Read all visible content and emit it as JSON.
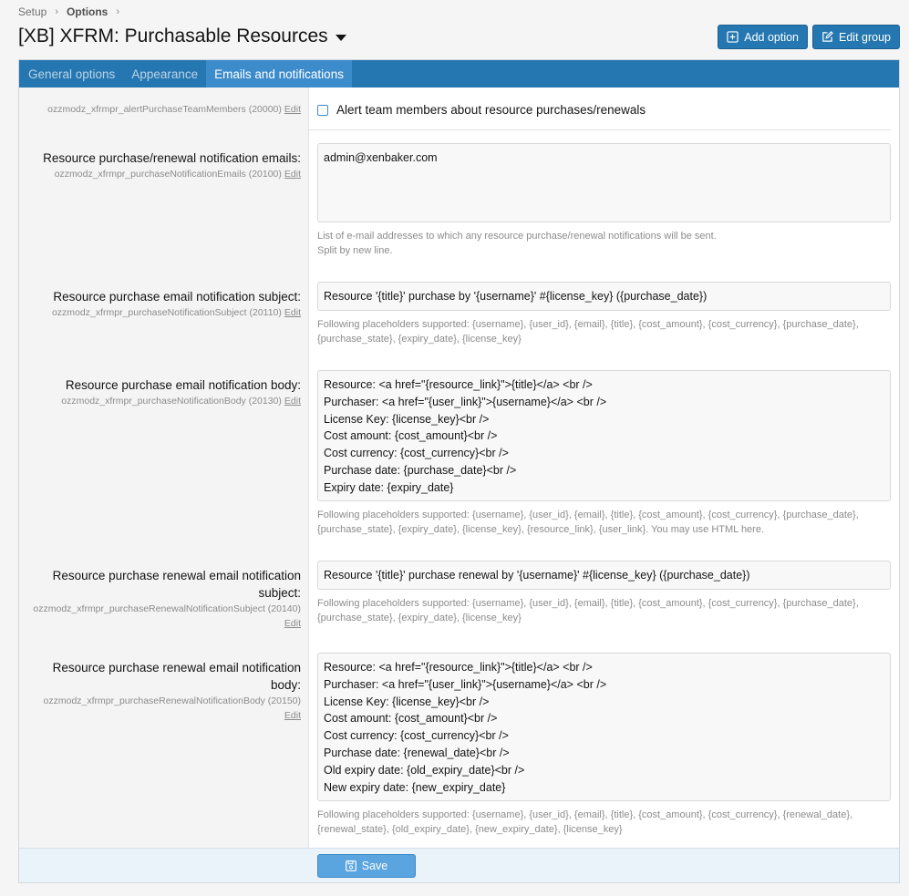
{
  "breadcrumb": {
    "items": [
      "Setup",
      "Options"
    ]
  },
  "page_title": "[XB] XFRM: Purchasable Resources",
  "buttons": {
    "add_option": "Add option",
    "edit_group": "Edit group"
  },
  "tabs": [
    {
      "label": "General options"
    },
    {
      "label": "Appearance"
    },
    {
      "label": "Emails and notifications"
    }
  ],
  "edit_label": "Edit",
  "options": {
    "alert_team": {
      "hint": "ozzmodz_xfrmpr_alertPurchaseTeamMembers (20000)",
      "checkbox_label": "Alert team members about resource purchases/renewals"
    },
    "notify_emails": {
      "label": "Resource purchase/renewal notification emails:",
      "hint": "ozzmodz_xfrmpr_purchaseNotificationEmails (20100)",
      "value": "admin@xenbaker.com",
      "explain": "List of e-mail addresses to which any resource purchase/renewal notifications will be sent.\nSplit by new line."
    },
    "purchase_subject": {
      "label": "Resource purchase email notification subject:",
      "hint": "ozzmodz_xfrmpr_purchaseNotificationSubject (20110)",
      "value": "Resource '{title}' purchase by '{username}' #{license_key} ({purchase_date})",
      "explain": "Following placeholders supported: {username}, {user_id}, {email}, {title}, {cost_amount}, {cost_currency}, {purchase_date}, {purchase_state}, {expiry_date}, {license_key}"
    },
    "purchase_body": {
      "label": "Resource purchase email notification body:",
      "hint": "ozzmodz_xfrmpr_purchaseNotificationBody (20130)",
      "value": "Resource: <a href=\"{resource_link}\">{title}</a> <br />\nPurchaser: <a href=\"{user_link}\">{username}</a> <br />\nLicense Key: {license_key}<br />\nCost amount: {cost_amount}<br />\nCost currency: {cost_currency}<br />\nPurchase date: {purchase_date}<br />\nExpiry date: {expiry_date}",
      "explain": "Following placeholders supported: {username}, {user_id}, {email}, {title}, {cost_amount}, {cost_currency}, {purchase_date}, {purchase_state}, {expiry_date}, {license_key}, {resource_link}, {user_link}. You may use HTML here."
    },
    "renewal_subject": {
      "label": "Resource purchase renewal email notification subject:",
      "hint": "ozzmodz_xfrmpr_purchaseRenewalNotificationSubject (20140)",
      "value": "Resource '{title}' purchase renewal by '{username}' #{license_key} ({purchase_date})",
      "explain": "Following placeholders supported: {username}, {user_id}, {email}, {title}, {cost_amount}, {cost_currency}, {purchase_date}, {purchase_state}, {expiry_date}, {license_key}"
    },
    "renewal_body": {
      "label": "Resource purchase renewal email notification body:",
      "hint": "ozzmodz_xfrmpr_purchaseRenewalNotificationBody (20150)",
      "value": "Resource: <a href=\"{resource_link}\">{title}</a> <br />\nPurchaser: <a href=\"{user_link}\">{username}</a> <br />\nLicense Key: {license_key}<br />\nCost amount: {cost_amount}<br />\nCost currency: {cost_currency}<br />\nPurchase date: {renewal_date}<br />\nOld expiry date: {old_expiry_date}<br />\nNew expiry date: {new_expiry_date}",
      "explain": "Following placeholders supported: {username}, {user_id}, {email}, {title}, {cost_amount}, {cost_currency}, {renewal_date}, {renewal_state}, {old_expiry_date}, {new_expiry_date}, {license_key}"
    }
  },
  "save_label": "Save",
  "colors": {
    "accent": "#2577b1",
    "tab_active": "#3c8bcb",
    "save": "#5aa4df"
  }
}
